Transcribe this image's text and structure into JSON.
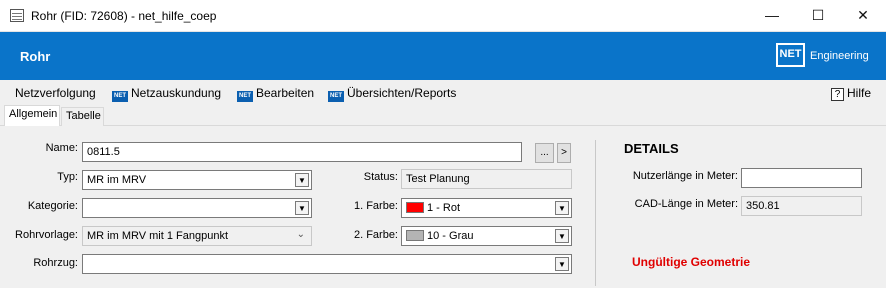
{
  "window": {
    "title": "Rohr (FID: 72608) - net_hilfe_coep",
    "minimize": "—",
    "maximize": "☐",
    "close": "✕"
  },
  "banner": {
    "title": "Rohr",
    "logo_mark": "NET",
    "logo_text": "Engineering"
  },
  "menu": {
    "items": [
      "Netzverfolgung",
      "Netzauskundung",
      "Bearbeiten",
      "Übersichten/Reports"
    ],
    "icon_label": "NET",
    "help": "Hilfe",
    "help_icon": "?"
  },
  "tabs": [
    "Allgemein",
    "Tabelle"
  ],
  "form": {
    "name_label": "Name:",
    "name_value": "0811.5",
    "name_btn_browse": "...",
    "name_btn_next": ">",
    "typ_label": "Typ:",
    "typ_value": "MR im MRV",
    "kategorie_label": "Kategorie:",
    "kategorie_value": "",
    "rohrvorlage_label": "Rohrvorlage:",
    "rohrvorlage_value": "MR im MRV mit 1 Fangpunkt",
    "rohrzug_label": "Rohrzug:",
    "rohrzug_value": "",
    "status_label": "Status:",
    "status_value": "Test Planung",
    "farbe1_label": "1. Farbe:",
    "farbe1_value": "1 - Rot",
    "farbe1_color": "#ff0000",
    "farbe2_label": "2. Farbe:",
    "farbe2_value": "10 - Grau",
    "farbe2_color": "#b4b4b4",
    "dropdown_arrow": "▼"
  },
  "details": {
    "title": "DETAILS",
    "nutzer_label": "Nutzerlänge in Meter:",
    "nutzer_value": "",
    "cad_label": "CAD-Länge in Meter:",
    "cad_value": "350.81",
    "error": "Ungültige Geometrie"
  },
  "colors": {
    "banner": "#0a74c9",
    "error": "#e00000"
  }
}
